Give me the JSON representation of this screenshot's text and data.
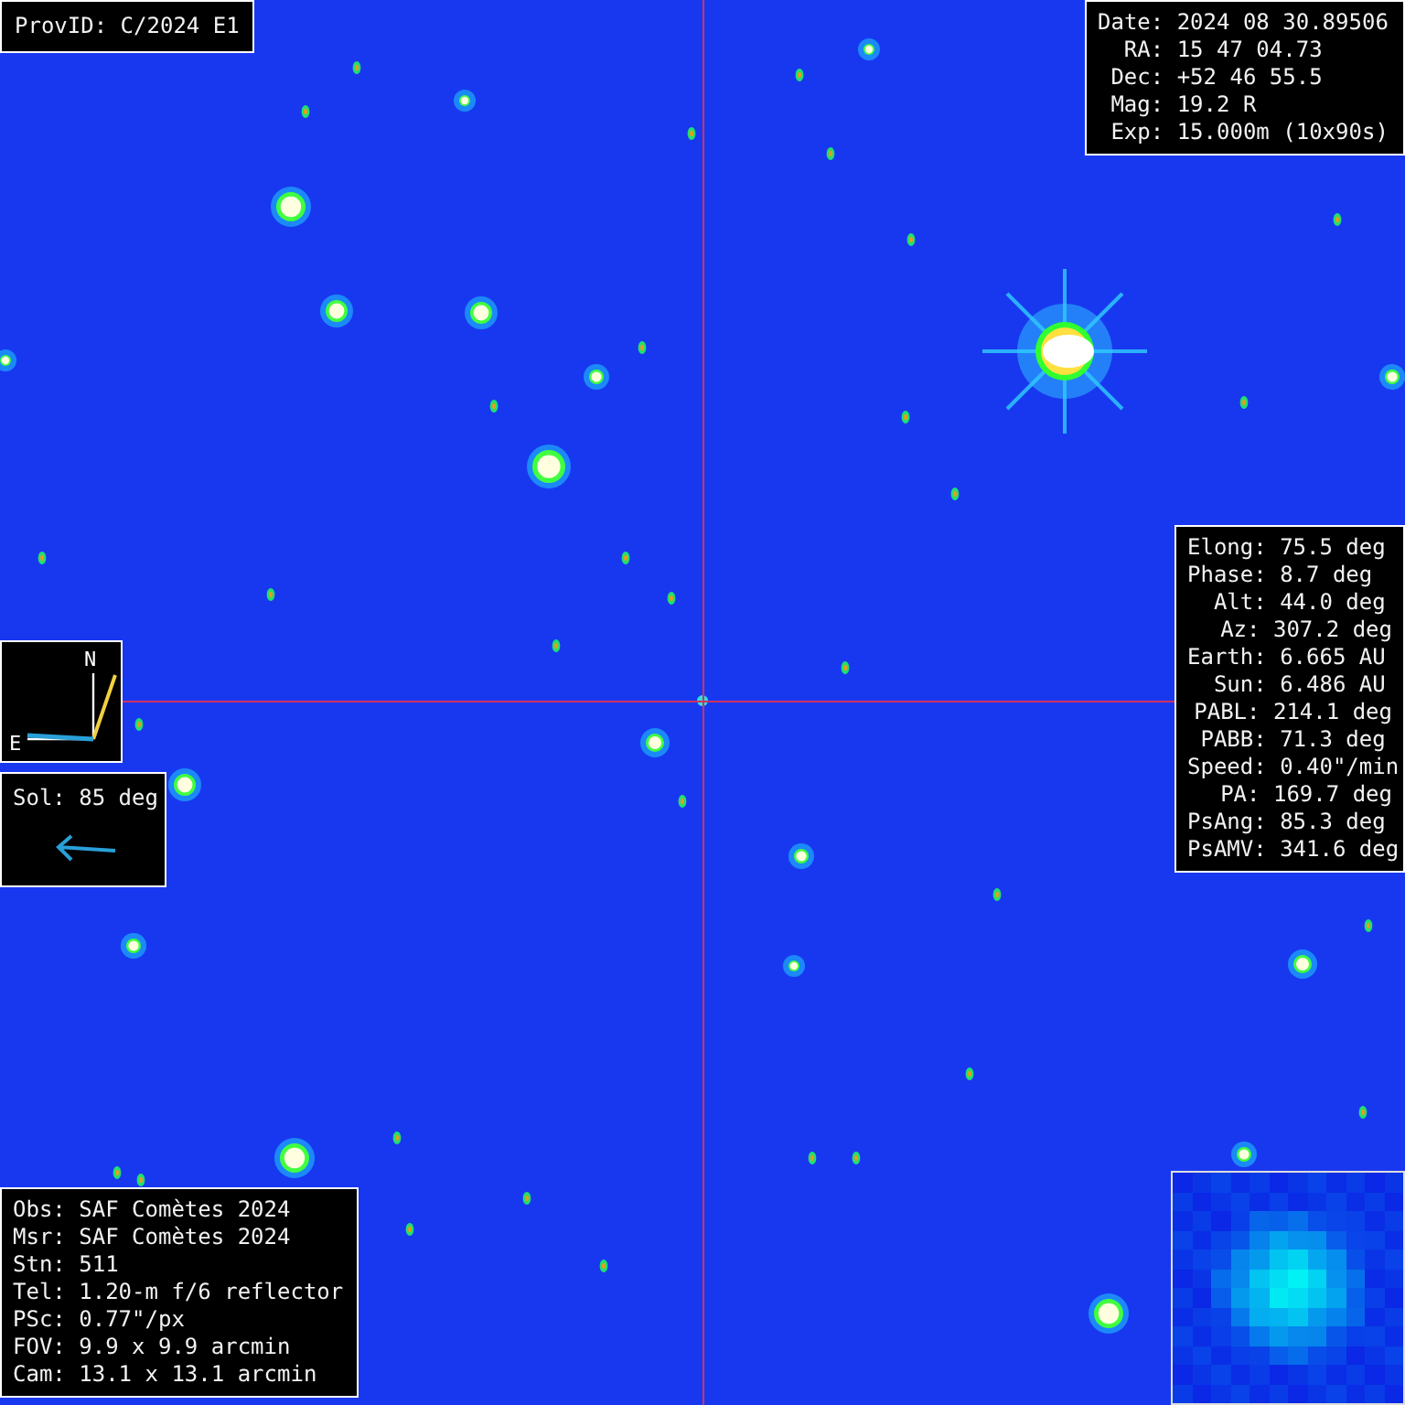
{
  "header": {
    "prov_id": "ProvID: C/2024 E1"
  },
  "observation": [
    {
      "label": "Date:",
      "value": "2024 08 30.89506"
    },
    {
      "label": "RA:",
      "value": "15 47 04.73"
    },
    {
      "label": "Dec:",
      "value": "+52 46 55.5"
    },
    {
      "label": "Mag:",
      "value": "19.2 R"
    },
    {
      "label": "Exp:",
      "value": "15.000m (10x90s)"
    }
  ],
  "geometry": [
    {
      "label": "Elong:",
      "value": "75.5 deg"
    },
    {
      "label": "Phase:",
      "value": "8.7 deg"
    },
    {
      "label": "Alt:",
      "value": "44.0 deg"
    },
    {
      "label": "Az:",
      "value": "307.2 deg"
    },
    {
      "label": "Earth:",
      "value": "6.665 AU"
    },
    {
      "label": "Sun:",
      "value": "6.486 AU"
    },
    {
      "label": "PABL:",
      "value": "214.1 deg"
    },
    {
      "label": "PABB:",
      "value": "71.3 deg"
    },
    {
      "label": "Speed:",
      "value": "0.40\"/min"
    },
    {
      "label": "PA:",
      "value": "169.7 deg"
    },
    {
      "label": "PsAng:",
      "value": "85.3 deg"
    },
    {
      "label": "PsAMV:",
      "value": "341.6 deg"
    }
  ],
  "compass": {
    "north": "N",
    "east": "E"
  },
  "sol": {
    "text": "Sol: 85 deg"
  },
  "site": [
    {
      "label": "Obs:",
      "value": "SAF Comètes 2024"
    },
    {
      "label": "Msr:",
      "value": "SAF Comètes 2024"
    },
    {
      "label": "Stn:",
      "value": "511"
    },
    {
      "label": "Tel:",
      "value": "1.20-m f/6 reflector"
    },
    {
      "label": "PSc:",
      "value": "0.77\"/px"
    },
    {
      "label": "FOV:",
      "value": "9.9 x 9.9 arcmin"
    },
    {
      "label": "Cam:",
      "value": "13.1 x 13.1 arcmin"
    }
  ]
}
